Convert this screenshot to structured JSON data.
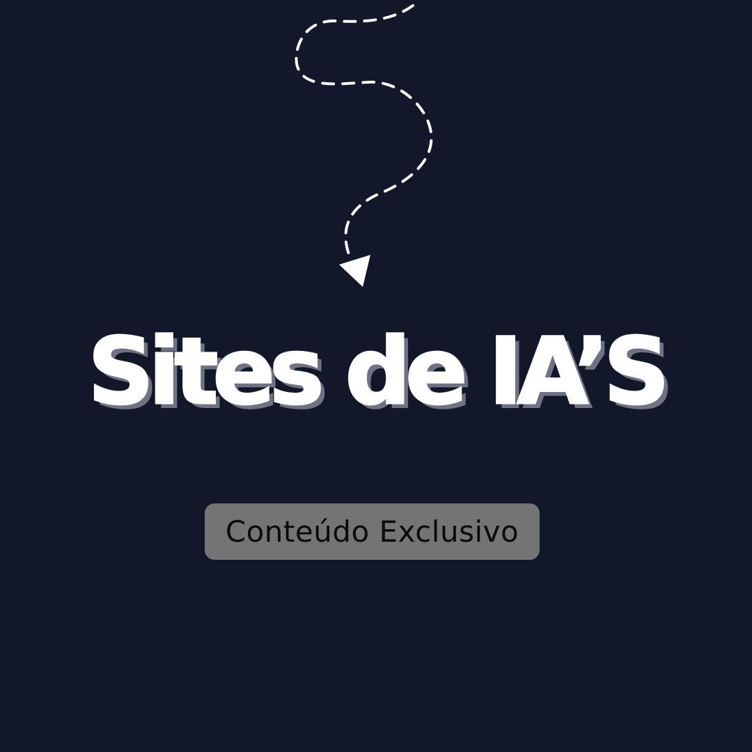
{
  "colors": {
    "background": "#12172a",
    "title_text": "#ffffff",
    "title_shadow": "#6e7282",
    "badge_background": "#747474",
    "badge_text": "#0b0b0b",
    "arrow": "#ffffff"
  },
  "decoration": {
    "arrow_icon": "dashed-curvy-arrow-down-icon"
  },
  "headline": {
    "title": "Sites de IA’S"
  },
  "badge": {
    "label": "Conteúdo Exclusivo"
  }
}
